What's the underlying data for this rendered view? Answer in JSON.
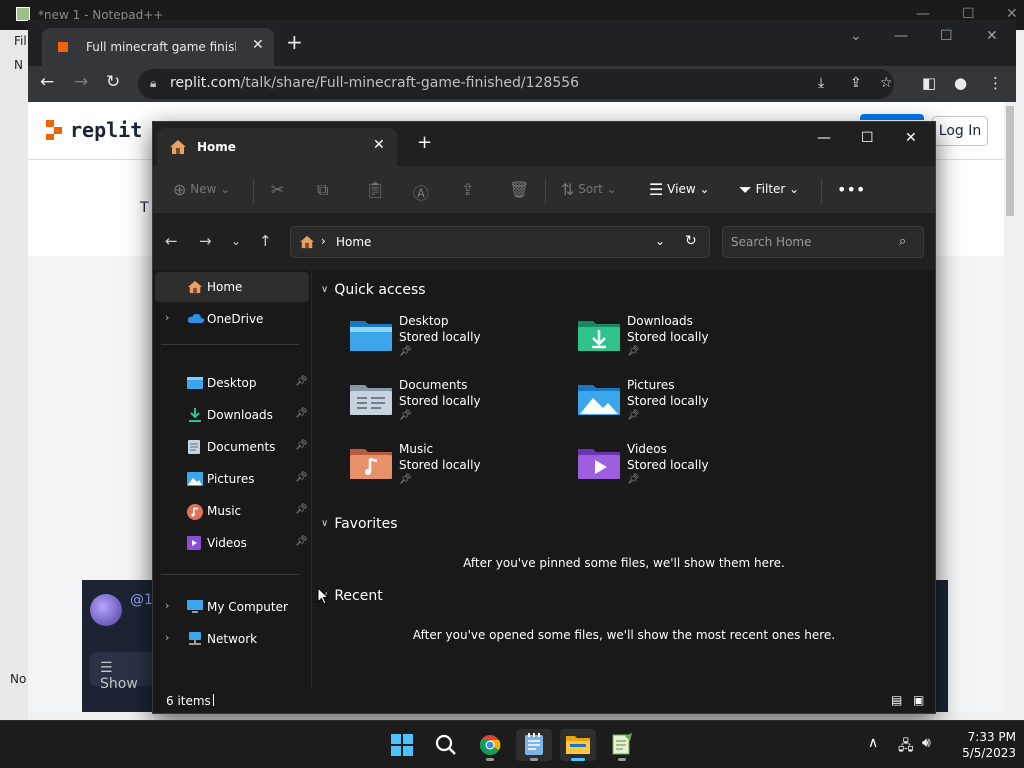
{
  "notepad": {
    "title": "*new 1 - Notepad++",
    "side_letters": [
      "Fil",
      "N"
    ],
    "bottom_text": "No"
  },
  "chrome": {
    "tab_title": "Full minecraft game finished - Re",
    "url_host": "replit.com",
    "url_path": "/talk/share/Full-minecraft-game-finished/128556",
    "page": {
      "logo_text": "replit",
      "login_label": "Log In",
      "card_text": "T",
      "user_handle": "@1",
      "show_label": "Show"
    }
  },
  "explorer": {
    "tab_title": "Home",
    "toolbar": {
      "new_label": "New",
      "sort_label": "Sort",
      "view_label": "View",
      "filter_label": "Filter"
    },
    "address": {
      "path": "Home",
      "search_placeholder": "Search Home"
    },
    "nav": {
      "home": "Home",
      "onedrive": "OneDrive",
      "pinned": [
        {
          "label": "Desktop",
          "icon": "desktop-icon"
        },
        {
          "label": "Downloads",
          "icon": "downloads-icon"
        },
        {
          "label": "Documents",
          "icon": "documents-icon"
        },
        {
          "label": "Pictures",
          "icon": "pictures-icon"
        },
        {
          "label": "Music",
          "icon": "music-icon"
        },
        {
          "label": "Videos",
          "icon": "videos-icon"
        }
      ],
      "my_computer": "My Computer",
      "network": "Network"
    },
    "quick_access": {
      "heading": "Quick access",
      "items": [
        {
          "name": "Desktop",
          "status": "Stored locally"
        },
        {
          "name": "Downloads",
          "status": "Stored locally"
        },
        {
          "name": "Documents",
          "status": "Stored locally"
        },
        {
          "name": "Pictures",
          "status": "Stored locally"
        },
        {
          "name": "Music",
          "status": "Stored locally"
        },
        {
          "name": "Videos",
          "status": "Stored locally"
        }
      ]
    },
    "favorites": {
      "heading": "Favorites",
      "empty_message": "After you've pinned some files, we'll show them here."
    },
    "recent": {
      "heading": "Recent",
      "empty_message": "After you've opened some files, we'll show the most recent ones here."
    },
    "status": {
      "item_count": "6 items"
    }
  },
  "taskbar": {
    "time": "7:33 PM",
    "date": "5/5/2023"
  },
  "colors": {
    "accent_folder": "#3ba7ea",
    "replit_orange": "#f26207",
    "explorer_bg": "#191919"
  }
}
